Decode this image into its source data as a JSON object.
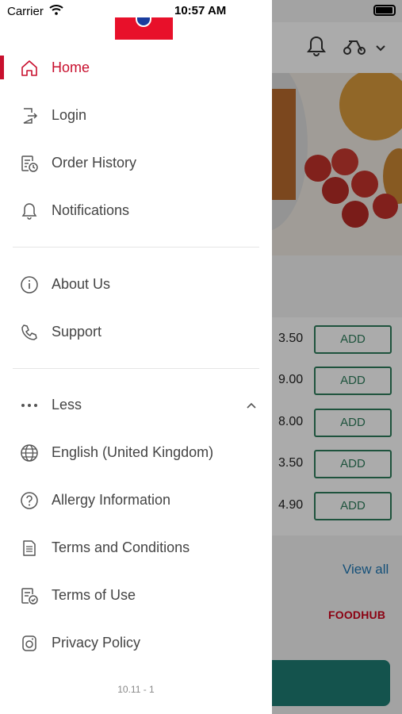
{
  "status_bar": {
    "carrier": "Carrier",
    "time": "10:57 AM"
  },
  "menu": {
    "primary": [
      {
        "label": "Home",
        "icon": "home-icon",
        "active": true
      },
      {
        "label": "Login",
        "icon": "login-icon"
      },
      {
        "label": "Order History",
        "icon": "order-history-icon"
      },
      {
        "label": "Notifications",
        "icon": "bell-icon"
      }
    ],
    "secondary": [
      {
        "label": "About Us",
        "icon": "info-icon"
      },
      {
        "label": "Support",
        "icon": "phone-icon"
      }
    ],
    "less_label": "Less",
    "tertiary": [
      {
        "label": "English (United Kingdom)",
        "icon": "globe-icon"
      },
      {
        "label": "Allergy Information",
        "icon": "question-icon"
      },
      {
        "label": "Terms and Conditions",
        "icon": "document-icon"
      },
      {
        "label": "Terms of Use",
        "icon": "document-check-icon"
      },
      {
        "label": "Privacy Policy",
        "icon": "privacy-icon"
      }
    ],
    "version": "10.11 - 1"
  },
  "background": {
    "prices": [
      "3.50",
      "9.00",
      "8.00",
      "3.50",
      "4.90"
    ],
    "add_label": "ADD",
    "view_all": "View all",
    "brand": "FOODHUB"
  },
  "colors": {
    "accent": "#c8102e",
    "add_border": "#2e7d5b",
    "cta": "#1f7d74",
    "link": "#1f77b4"
  }
}
